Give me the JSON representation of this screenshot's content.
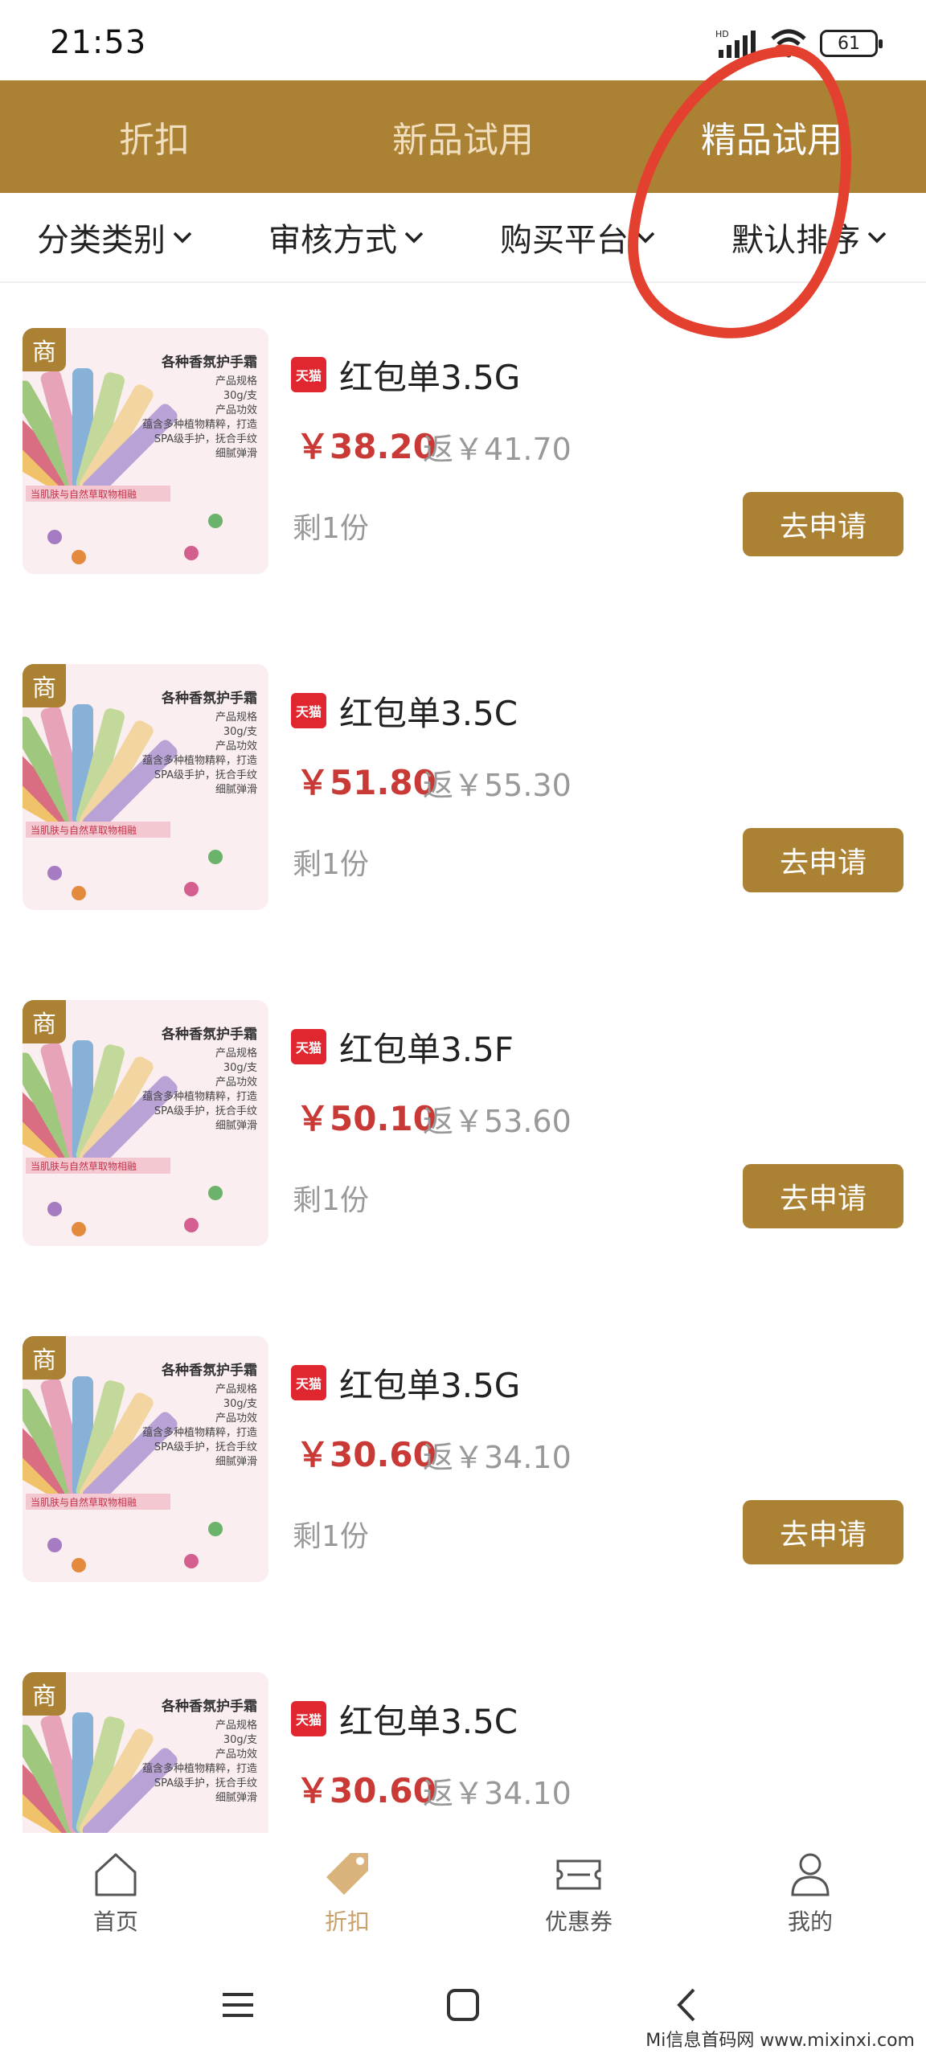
{
  "status_bar": {
    "time": "21:53",
    "network": "HD",
    "battery": "61"
  },
  "top_tabs": [
    {
      "label": "折扣",
      "active": false
    },
    {
      "label": "新品试用",
      "active": false
    },
    {
      "label": "精品试用",
      "active": true
    }
  ],
  "filters": [
    {
      "label": "分类类别"
    },
    {
      "label": "审核方式"
    },
    {
      "label": "购买平台"
    },
    {
      "label": "默认排序"
    }
  ],
  "product_image": {
    "badge": "商",
    "title": "各种香氛护手霜",
    "lines": [
      "产品规格",
      "30g/支",
      "产品功效",
      "蕴含多种植物精粹，打造",
      "SPA级手护，抚合手纹",
      "细腻弹滑"
    ],
    "stripe": "当肌肤与自然草取物相融"
  },
  "shop_icon_label": "天猫",
  "items": [
    {
      "title": "红包单3.5G",
      "price": "￥38.20",
      "refund": "返￥41.70",
      "remain": "剩1份",
      "button": "去申请"
    },
    {
      "title": "红包单3.5C",
      "price": "￥51.80",
      "refund": "返￥55.30",
      "remain": "剩1份",
      "button": "去申请"
    },
    {
      "title": "红包单3.5F",
      "price": "￥50.10",
      "refund": "返￥53.60",
      "remain": "剩1份",
      "button": "去申请"
    },
    {
      "title": "红包单3.5G",
      "price": "￥30.60",
      "refund": "返￥34.10",
      "remain": "剩1份",
      "button": "去申请"
    },
    {
      "title": "红包单3.5C",
      "price": "￥30.60",
      "refund": "返￥34.10",
      "remain": "",
      "button": ""
    }
  ],
  "bottom_nav": [
    {
      "label": "首页",
      "icon": "home-icon",
      "active": false
    },
    {
      "label": "折扣",
      "icon": "tag-icon",
      "active": true
    },
    {
      "label": "优惠券",
      "icon": "ticket-icon",
      "active": false
    },
    {
      "label": "我的",
      "icon": "user-icon",
      "active": false
    }
  ],
  "watermark": "Mi信息首码网 www.mixinxi.com",
  "colors": {
    "brand": "#ab8133",
    "price": "#c93a36",
    "annotation": "#e4402f"
  }
}
